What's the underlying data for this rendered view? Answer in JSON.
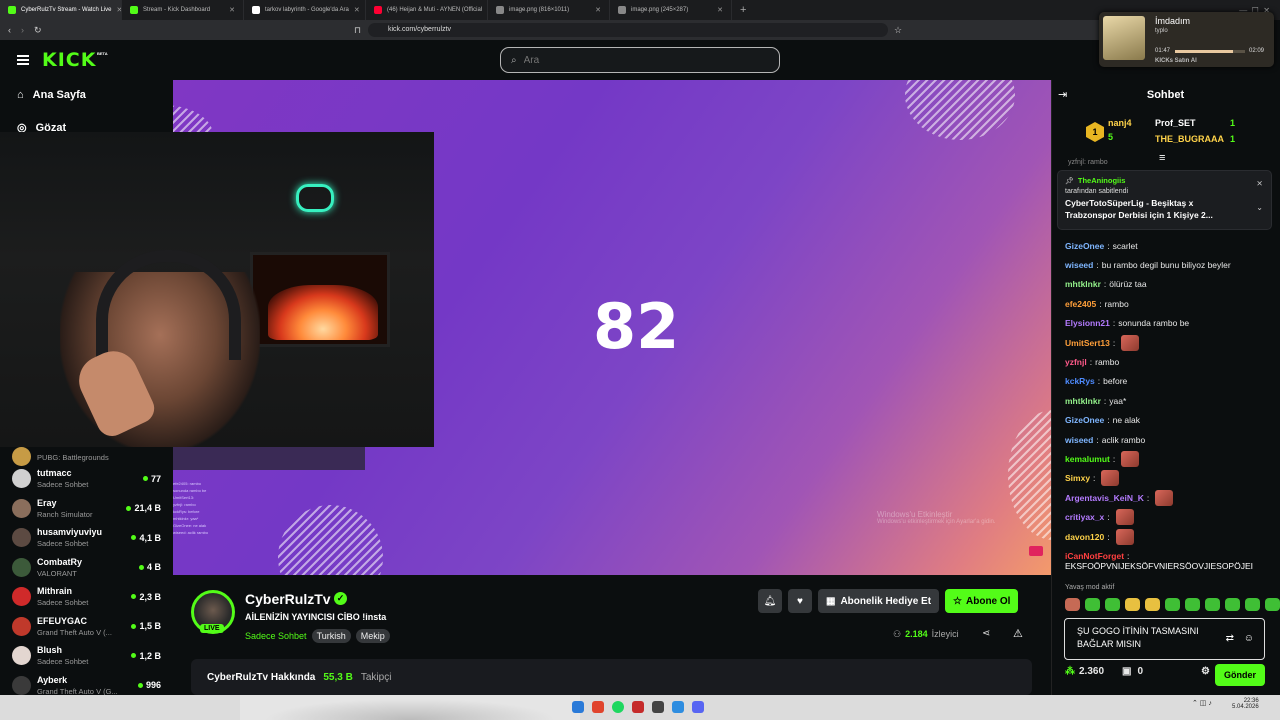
{
  "browser": {
    "tabs": [
      {
        "label": "CyberRulzTv Stream - Watch Live",
        "color": "#53fc18",
        "active": true
      },
      {
        "label": "Stream - Kick Dashboard",
        "color": "#53fc18"
      },
      {
        "label": "tarkov labyrinth - Google'da Ara",
        "color": "#ffffff"
      },
      {
        "label": "(46) Heijan & Muti - AYNEN (Official",
        "color": "#ff0033"
      },
      {
        "label": "image.png (816×1011)",
        "color": "#888888"
      },
      {
        "label": "image.png (245×287)",
        "color": "#888888"
      }
    ],
    "new_tab": "+",
    "url": "kick.com/cyberrulztv"
  },
  "media": {
    "title": "İmdadım",
    "artist": "typlo",
    "time_elapsed": "01:47",
    "time_total": "02:09",
    "behind_text": "KICKs Satın Al",
    "progress": 0.83
  },
  "header": {
    "logo": "KICK",
    "beta": "BETA",
    "search_placeholder": "Ara"
  },
  "nav": {
    "home": "Ana Sayfa",
    "browse": "Gözat"
  },
  "channels": [
    {
      "name": "",
      "sub": "PUBG: Battlegrounds",
      "viewers": "",
      "color": "#c79b45"
    },
    {
      "name": "tutmacc",
      "sub": "Sadece Sohbet",
      "viewers": "77",
      "color": "#d0d0d0"
    },
    {
      "name": "Eray",
      "sub": "Ranch Simulator",
      "viewers": "21,4 B",
      "color": "#8a6e5c"
    },
    {
      "name": "husamviyuviyu",
      "sub": "Sadece Sohbet",
      "viewers": "4,1 B",
      "color": "#5c4a42"
    },
    {
      "name": "CombatRy",
      "sub": "VALORANT",
      "viewers": "4 B",
      "color": "#3c5a3a"
    },
    {
      "name": "Mithrain",
      "sub": "Sadece Sohbet",
      "viewers": "2,3 B",
      "color": "#d02a2a"
    },
    {
      "name": "EFEUYGAC",
      "sub": "Grand Theft Auto V (...",
      "viewers": "1,5 B",
      "color": "#c0392b"
    },
    {
      "name": "Blush",
      "sub": "Sadece Sohbet",
      "viewers": "1,2 B",
      "color": "#e3d6d0"
    },
    {
      "name": "Ayberk",
      "sub": "Grand Theft Auto V (G...",
      "viewers": "996",
      "color": "#3a3a3a"
    }
  ],
  "player": {
    "center_text": "82",
    "watermark_line1": "Windows'u Etkinleştir",
    "watermark_line2": "Windows'u etkinleştirmek için Ayarlar'a gidin.",
    "mini_chat": [
      "efe2405: rambo",
      "sonunda rambo be",
      "UmitSert13:",
      "yzfnjl: rambo",
      "kckRys: before",
      "mhtklnkr: yaa*",
      "GizeOnee: ne alak",
      "wiseed: aclik rambo"
    ]
  },
  "stream": {
    "streamer": "CyberRulzTv",
    "live_label": "LIVE",
    "title": "AİLENİZİN YAYINCISI CİBO !insta",
    "category": "Sadece Sohbet",
    "tags": [
      "Turkish",
      "Mekip"
    ],
    "viewers": "2.184",
    "viewers_label": "İzleyici",
    "gift_sub_label": "Abonelik Hediye Et",
    "subscribe_label": "Abone Ol",
    "about_title": "CyberRulzTv Hakkında",
    "followers": "55,3 B",
    "followers_label": "Takipçi"
  },
  "chat": {
    "title": "Sohbet",
    "gifters": [
      {
        "name": "nanj4",
        "count": "5"
      },
      {
        "name": "Prof_SET",
        "count": "1"
      },
      {
        "name": "THE_BUGRAAA",
        "count": "1"
      }
    ],
    "rank": "1",
    "pinned_by": "TheAninogiis",
    "pinned_by_label": "tarafından sabitlendi",
    "pinned_text": "CyberTotoSüperLig - Beşiktaş x Trabzonspor Derbisi için 1 Kişiye 2...",
    "partial_line": "yzfnjl: rambo",
    "messages": [
      {
        "user": "GizeOnee",
        "text": "scarlet",
        "color": "#7fb6ff"
      },
      {
        "user": "wiseed",
        "text": "bu rambo degil bunu biliyoz beyler",
        "color": "#7fb6ff"
      },
      {
        "user": "mhtklnkr",
        "text": "ölürüz taa",
        "color": "#93f08a"
      },
      {
        "user": "efe2405",
        "text": "rambo",
        "color": "#ff9f3a"
      },
      {
        "user": "Elysionn21",
        "text": "sonunda rambo be",
        "color": "#b47bff"
      },
      {
        "user": "UmitSert13",
        "text": "",
        "color": "#ff9f3a",
        "emote": true
      },
      {
        "user": "yzfnjl",
        "text": "rambo",
        "color": "#ff5a8a"
      },
      {
        "user": "kckRys",
        "text": "before",
        "color": "#4f8cff"
      },
      {
        "user": "mhtklnkr",
        "text": "yaa*",
        "color": "#93f08a"
      },
      {
        "user": "GizeOnee",
        "text": "ne alak",
        "color": "#7fb6ff"
      },
      {
        "user": "wiseed",
        "text": "aclik rambo",
        "color": "#7fb6ff"
      },
      {
        "user": "kemalumut",
        "text": "",
        "color": "#53fc18",
        "emote": true
      },
      {
        "user": "Simxy",
        "text": "",
        "color": "#ffd34a",
        "emote": true
      },
      {
        "user": "Argentavis_KeiN_K",
        "text": "",
        "color": "#b47bff",
        "emote": true
      },
      {
        "user": "critiyax_x",
        "text": "",
        "color": "#b47bff",
        "emote": true
      },
      {
        "user": "davon120",
        "text": "",
        "color": "#ffd34a",
        "emote": true
      },
      {
        "user": "iCanNotForget",
        "text": "",
        "color": "#ff4040"
      }
    ],
    "last_message": "EKSFOÖPVNIJEKSÖFVNIERSÖOVJIESOPÖJEI",
    "slow_mode": "Yavaş mod aktif",
    "input_text": "ŞU GOGO İTİNİN TASMASINI BAĞLAR MISIN",
    "points": "2.360",
    "inventory": "0",
    "send_label": "Gönder"
  },
  "taskbar": {
    "time": "22:36",
    "date": "5.04.2026"
  }
}
